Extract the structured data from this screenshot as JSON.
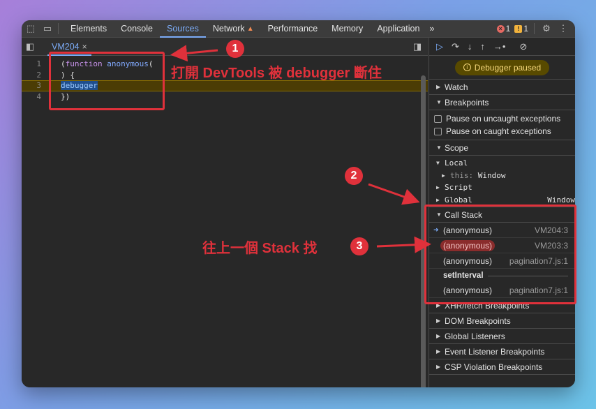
{
  "toolbar": {
    "tabs": [
      "Elements",
      "Console",
      "Sources",
      "Network",
      "Performance",
      "Memory",
      "Application"
    ],
    "active_tab": "Sources",
    "more": "»",
    "errors": "1",
    "warnings": "1"
  },
  "editor": {
    "file_tab": "VM204",
    "close": "×",
    "lines": [
      {
        "num": "1",
        "text": "(function anonymous("
      },
      {
        "num": "2",
        "text": ") {"
      },
      {
        "num": "3",
        "text": "debugger"
      },
      {
        "num": "4",
        "text": "})"
      }
    ]
  },
  "debugger": {
    "paused_label": "Debugger paused",
    "sections": {
      "watch": "Watch",
      "breakpoints": "Breakpoints",
      "pause_uncaught": "Pause on uncaught exceptions",
      "pause_caught": "Pause on caught exceptions",
      "scope": "Scope",
      "local": "Local",
      "this_key": "this",
      "this_val": "Window",
      "script": "Script",
      "global": "Global",
      "global_val": "Window",
      "call_stack": "Call Stack",
      "xhr": "XHR/fetch Breakpoints",
      "dom": "DOM Breakpoints",
      "global_listeners": "Global Listeners",
      "event_listener": "Event Listener Breakpoints",
      "csp": "CSP Violation Breakpoints"
    },
    "call_stack": [
      {
        "fn": "(anonymous)",
        "loc": "VM204:3"
      },
      {
        "fn": "(anonymous)",
        "loc": "VM203:3"
      },
      {
        "fn": "(anonymous)",
        "loc": "pagination7.js:1"
      },
      {
        "fn": "setInterval",
        "loc": ""
      },
      {
        "fn": "(anonymous)",
        "loc": "pagination7.js:1"
      }
    ]
  },
  "annotations": {
    "step1_num": "1",
    "step1_text": "打開 DevTools 被 debugger 斷住",
    "step2_num": "2",
    "step3_num": "3",
    "step3_text": "往上一個 Stack 找",
    "color": "#e0313b"
  }
}
